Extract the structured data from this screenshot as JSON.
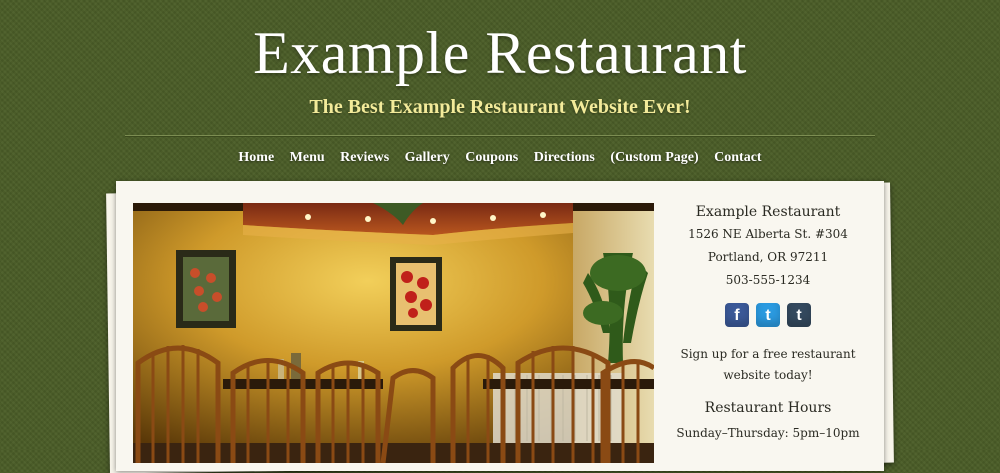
{
  "header": {
    "title": "Example Restaurant",
    "tagline": "The Best Example Restaurant Website Ever!"
  },
  "nav": {
    "items": [
      "Home",
      "Menu",
      "Reviews",
      "Gallery",
      "Coupons",
      "Directions",
      "(Custom Page)",
      "Contact"
    ]
  },
  "sidebar": {
    "name": "Example Restaurant",
    "address_line1": "1526 NE Alberta St. #304",
    "address_line2": "Portland, OR 97211",
    "phone": "503-555-1234",
    "social": [
      {
        "icon": "facebook-icon",
        "glyph": "f",
        "color": "#3b5998"
      },
      {
        "icon": "twitter-icon",
        "glyph": "t",
        "color": "#2b9ae0"
      },
      {
        "icon": "tumblr-icon",
        "glyph": "t",
        "color": "#34495e"
      }
    ],
    "signup_line1": "Sign up for a free restaurant",
    "signup_line2": "website today!",
    "hours_title": "Restaurant Hours",
    "hours_line": "Sunday–Thursday: 5pm–10pm"
  },
  "colors": {
    "background": "#4a5d27",
    "tagline": "#f3eb9a",
    "card": "#f9f7f0"
  }
}
